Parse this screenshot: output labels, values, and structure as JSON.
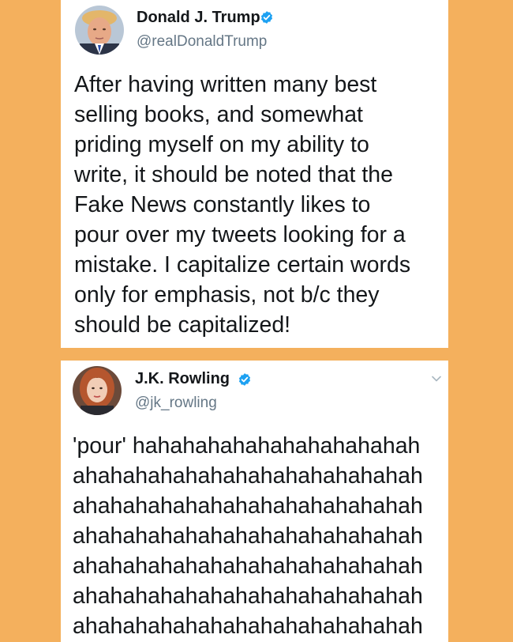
{
  "colors": {
    "background": "#F4B05D",
    "card": "#FFFFFF",
    "verified_badge": "#1DA1F2",
    "handle_text": "#657786",
    "body_text": "#14171A"
  },
  "tweets": [
    {
      "author_name": "Donald J. Trump",
      "handle": "@realDonaldTrump",
      "verified_icon": "verified-badge-icon",
      "text_lines": [
        "After having written many best",
        "selling books, and somewhat",
        "priding myself on my ability to",
        "write, it should be noted that the",
        "Fake News constantly likes to",
        "pour over my tweets looking for a",
        "mistake. I capitalize certain words",
        "only for emphasis, not b/c they",
        "should be capitalized!"
      ]
    },
    {
      "author_name": "J.K. Rowling",
      "handle": "@jk_rowling",
      "verified_icon": "verified-badge-icon",
      "menu_icon": "chevron-down-icon",
      "text_lines": [
        "'pour' hahahahahahahahahahahah",
        "ahahahahahahahahahahahahahah",
        "ahahahahahahahahahahahahahah",
        "ahahahahahahahahahahahahahah",
        "ahahahahahahahahahahahahahah",
        "ahahahahahahahahahahahahahah",
        "ahahahahahahahahahahahahahah"
      ]
    }
  ]
}
